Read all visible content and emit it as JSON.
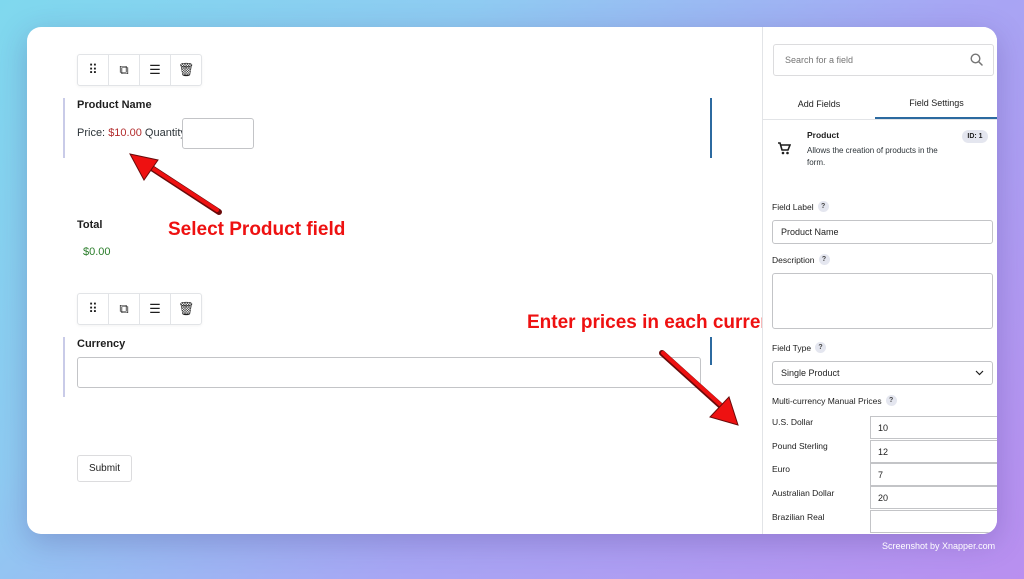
{
  "canvas": {
    "product_toolbar": [
      {
        "name": "drag-handle-icon",
        "glyph": "⠿"
      },
      {
        "name": "duplicate-icon",
        "glyph": "⧉"
      },
      {
        "name": "settings-sliders-icon",
        "glyph": "☰"
      },
      {
        "name": "trash-icon",
        "glyph": "🗑"
      }
    ],
    "product": {
      "label": "Product Name",
      "price_prefix": "Price:",
      "price_value": "$10.00",
      "quantity_label": "Quantity",
      "quantity_value": ""
    },
    "total": {
      "label": "Total",
      "value": "$0.00"
    },
    "currency": {
      "label": "Currency",
      "selected": ""
    },
    "submit_label": "Submit"
  },
  "annotations": {
    "select_product": "Select Product field",
    "enter_prices": "Enter prices in each currency"
  },
  "panel": {
    "search_placeholder": "Search for a field",
    "tabs": [
      "Add Fields",
      "Field Settings"
    ],
    "active_tab": "Field Settings",
    "field_info": {
      "title": "Product",
      "description": "Allows the creation of products in the form.",
      "id_badge": "ID: 1"
    },
    "field_label": {
      "label": "Field Label",
      "value": "Product Name"
    },
    "description": {
      "label": "Description",
      "value": ""
    },
    "field_type": {
      "label": "Field Type",
      "selected": "Single Product"
    },
    "multi_currency": {
      "label": "Multi-currency Manual Prices",
      "currencies": [
        {
          "name": "U.S. Dollar",
          "value": "10"
        },
        {
          "name": "Pound Sterling",
          "value": "12"
        },
        {
          "name": "Euro",
          "value": "7"
        },
        {
          "name": "Australian Dollar",
          "value": "20"
        },
        {
          "name": "Brazilian Real",
          "value": ""
        }
      ]
    },
    "help_glyph": "?"
  },
  "watermark": "Screenshot by Xnapper.com",
  "colors": {
    "price_red": "#b32d2e",
    "total_green": "#2a7d2a",
    "annotation_red": "#ee1111",
    "selected_bar": "#2c6aa0"
  }
}
